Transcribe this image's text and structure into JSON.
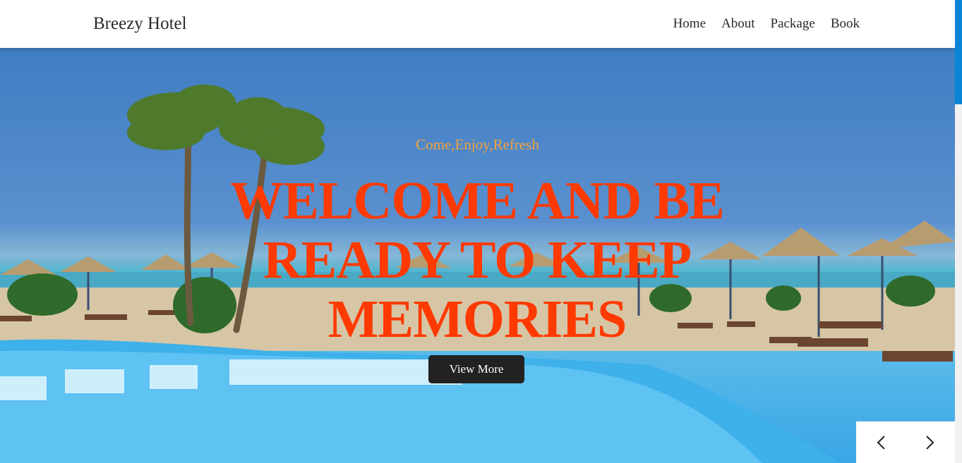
{
  "navbar": {
    "brand": "Breezy Hotel",
    "links": [
      "Home",
      "About",
      "Package",
      "Book"
    ]
  },
  "hero": {
    "tagline": "Come,Enjoy,Refresh",
    "headline": "WELCOME AND BE READY TO KEEP MEMORIES",
    "cta_label": "View More"
  },
  "carousel": {
    "prev_icon": "chevron-left-icon",
    "next_icon": "chevron-right-icon"
  },
  "colors": {
    "headline": "#ff3a00",
    "tagline": "#f2a03a",
    "cta_bg": "#222222",
    "scroll_thumb": "#0a84d6"
  }
}
